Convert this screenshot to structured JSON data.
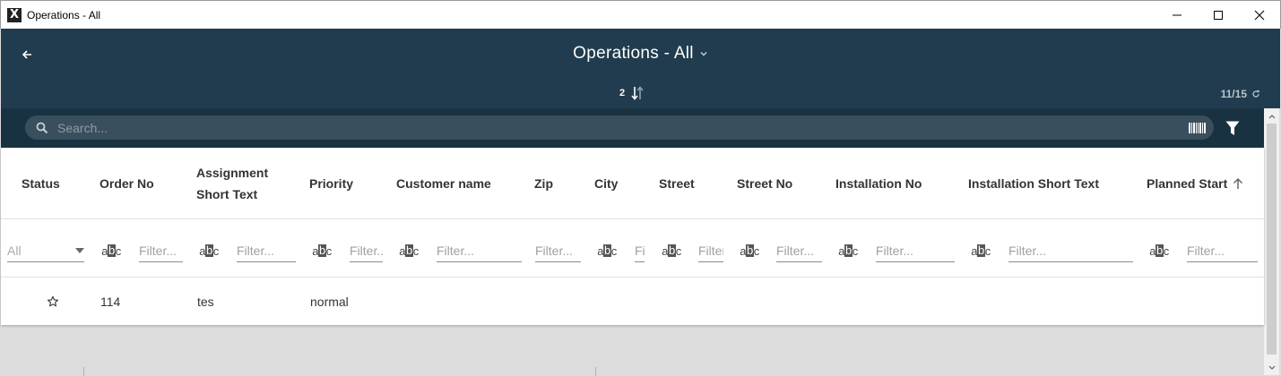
{
  "window": {
    "title": "Operations - All",
    "app_icon_glyph": "X",
    "controls": [
      "minimize-icon",
      "maximize-icon",
      "close-icon"
    ]
  },
  "header": {
    "back_icon": "arrow-left-icon",
    "title": "Operations - All",
    "title_icon": "chevron-down-icon",
    "sort_count": "2",
    "sort_icon": "sort-arrows-icon",
    "record_count": "11/15",
    "refresh_icon": "refresh-icon",
    "background_color": "#213c4e"
  },
  "search": {
    "placeholder": "Search...",
    "search_icon": "magnifier-icon",
    "barcode_icon": "barcode-icon",
    "filter_icon": "filter-funnel-icon"
  },
  "grid": {
    "columns": [
      {
        "key": "status",
        "label": "Status"
      },
      {
        "key": "order_no",
        "label": "Order No"
      },
      {
        "key": "assignment_short_text",
        "label": "Assignment Short Text"
      },
      {
        "key": "priority",
        "label": "Priority"
      },
      {
        "key": "customer_name",
        "label": "Customer name"
      },
      {
        "key": "zip",
        "label": "Zip"
      },
      {
        "key": "city",
        "label": "City"
      },
      {
        "key": "street",
        "label": "Street"
      },
      {
        "key": "street_no",
        "label": "Street No"
      },
      {
        "key": "installation_no",
        "label": "Installation No"
      },
      {
        "key": "installation_short_text",
        "label": "Installation Short Text"
      },
      {
        "key": "planned_start",
        "label": "Planned Start",
        "sort": "ascending"
      }
    ],
    "status_filter": {
      "selected": "All"
    },
    "text_filter_icon": "abc-text-filter-icon",
    "filter_placeholders": {
      "order_no": "Filter...",
      "assignment_short_text": "Filter...",
      "priority": "Filter...",
      "customer_name": "Filter...",
      "zip": "Filter...",
      "city": "Filter...",
      "street": "Filter...",
      "street_no": "Filter...",
      "installation_no": "Filter...",
      "installation_short_text": "Filter...",
      "planned_start": "Filter..."
    },
    "rows": [
      {
        "status_icon": "star-outline-icon",
        "order_no": "114",
        "assignment_short_text": "tes",
        "priority": "normal",
        "customer_name": "",
        "zip": "",
        "city": "",
        "street": "",
        "street_no": "",
        "installation_no": "",
        "installation_short_text": "",
        "planned_start": ""
      }
    ]
  }
}
